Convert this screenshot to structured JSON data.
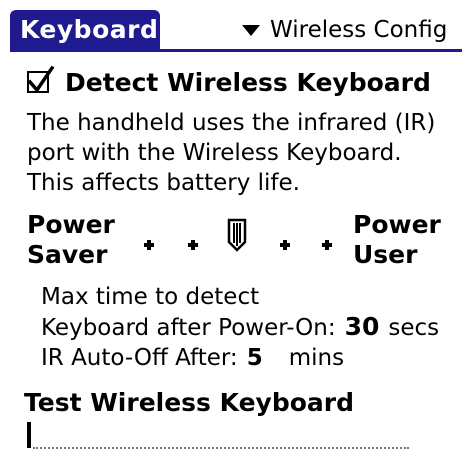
{
  "title": {
    "label": "Keyboard"
  },
  "menu": {
    "label": "Wireless Config",
    "icon": "triangle-down-icon"
  },
  "detect": {
    "label": "Detect Wireless Keyboard",
    "checked": true
  },
  "description": {
    "lines": [
      "The handheld uses the infrared (IR)",
      "port with the Wireless Keyboard.",
      "This affects battery life."
    ]
  },
  "power": {
    "left_lines": [
      "Power",
      "Saver"
    ],
    "right_lines": [
      "Power",
      "User"
    ],
    "level": 0.5
  },
  "timing": {
    "line1": "Max time to detect",
    "line2_label": "Keyboard after Power-On:",
    "detect_value": "30",
    "detect_unit": "secs",
    "ir_label": "IR Auto-Off After:",
    "ir_value": "5",
    "ir_unit": "mins"
  },
  "test": {
    "label": "Test Wireless Keyboard",
    "value": ""
  },
  "colors": {
    "title_bar": "#1f1a8f",
    "text": "#000000",
    "background": "#ffffff"
  }
}
